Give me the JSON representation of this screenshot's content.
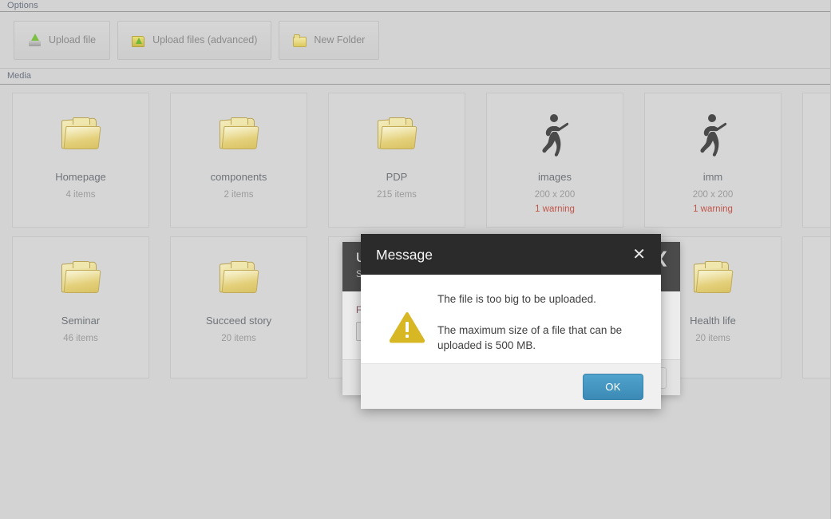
{
  "options_bar": {
    "label": "Options"
  },
  "toolbar": {
    "buttons": [
      {
        "label": "Upload file",
        "icon": "upload-file-icon"
      },
      {
        "label": "Upload files (advanced)",
        "icon": "upload-files-advanced-icon"
      },
      {
        "label": "New Folder",
        "icon": "new-folder-icon"
      }
    ]
  },
  "media_bar": {
    "label": "Media"
  },
  "grid": {
    "row1": [
      {
        "name": "Homepage",
        "meta": "4 items",
        "kind": "folder",
        "warning": ""
      },
      {
        "name": "components",
        "meta": "2 items",
        "kind": "folder",
        "warning": ""
      },
      {
        "name": "PDP",
        "meta": "215 items",
        "kind": "folder",
        "warning": ""
      },
      {
        "name": "images",
        "meta": "200 x 200",
        "kind": "image",
        "warning": "1 warning"
      },
      {
        "name": "imm",
        "meta": "200 x 200",
        "kind": "image",
        "warning": "1 warning"
      },
      {
        "name": "",
        "meta": "",
        "kind": "folder",
        "warning": ""
      }
    ],
    "row2": [
      {
        "name": "Seminar",
        "meta": "46 items",
        "kind": "folder",
        "warning": ""
      },
      {
        "name": "Succeed story",
        "meta": "20 items",
        "kind": "folder",
        "warning": ""
      },
      {
        "name": "",
        "meta": "",
        "kind": "folder",
        "warning": ""
      },
      {
        "name": "",
        "meta": "",
        "kind": "folder",
        "warning": ""
      },
      {
        "name": "Health life",
        "meta": "20 items",
        "kind": "folder",
        "warning": ""
      },
      {
        "name": "",
        "meta": "",
        "kind": "folder",
        "warning": ""
      }
    ]
  },
  "upload_dialog": {
    "title": "U",
    "subtitle": "Se",
    "field_label": "Fil",
    "collapse_icon": "chevron-left-icon"
  },
  "message_dialog": {
    "title": "Message",
    "close_icon": "close-icon",
    "warning_icon": "warning-triangle-icon",
    "line1": "The file is too big to be uploaded.",
    "line2": "The maximum size of a file that can be uploaded is 500 MB.",
    "ok_label": "OK"
  },
  "colors": {
    "page_bg": "#d3d3d3",
    "tile_bg": "#d6d6d6",
    "dialog_header": "#2b2b2b",
    "bg_dialog_header": "#4b4b4b",
    "accent_button": "#4293c2",
    "warning_yellow": "#d7b724",
    "warning_text": "#c0564a"
  }
}
